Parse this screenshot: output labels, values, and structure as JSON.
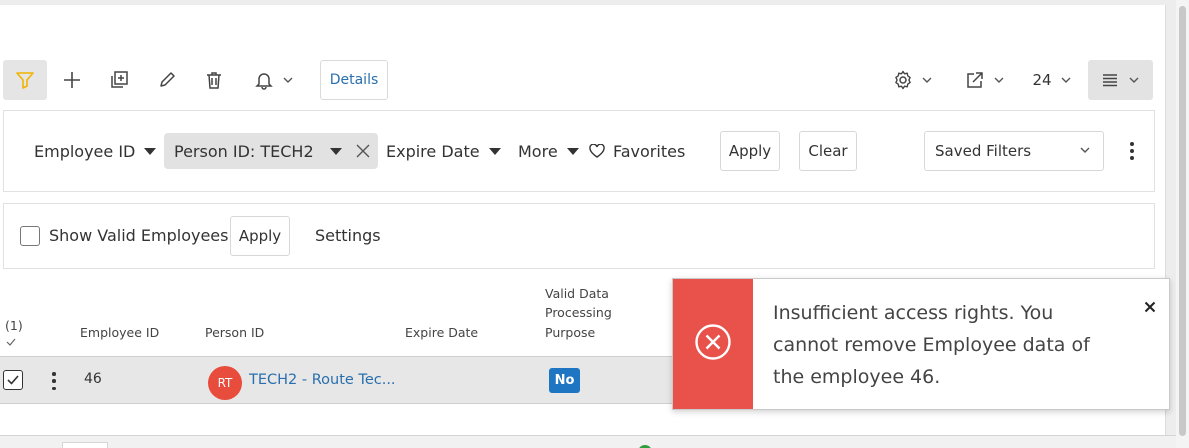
{
  "toolbar": {
    "details_label": "Details",
    "page_size": "24",
    "icons": [
      "filter-icon",
      "plus-icon",
      "duplicate-icon",
      "pencil-icon",
      "trash-icon",
      "bell-icon",
      "gear-icon",
      "export-icon",
      "list-view-icon"
    ]
  },
  "filters": {
    "employee_id": "Employee ID",
    "person_id": "Person ID: TECH2",
    "expire_date": "Expire Date",
    "more": "More",
    "favorites": "Favorites",
    "apply": "Apply",
    "clear": "Clear",
    "saved_filters": "Saved Filters"
  },
  "options": {
    "show_valid_employees": "Show Valid Employees",
    "apply": "Apply",
    "settings": "Settings"
  },
  "grid": {
    "selection_count": "(1)",
    "columns": {
      "employee_id": "Employee ID",
      "person_id": "Person ID",
      "expire_date": "Expire Date",
      "valid_purpose_1": "Valid Data",
      "valid_purpose_2": "Processing",
      "valid_purpose_3": "Purpose"
    },
    "rows": [
      {
        "employee_id": "46",
        "avatar_initials": "RT",
        "person": "TECH2 - Route Tec...",
        "valid_purpose": "No"
      }
    ]
  },
  "toast": {
    "message": "Insufficient access rights. You cannot remove Employee data of the employee 46."
  },
  "colors": {
    "accent_blue": "#1e76c2",
    "link_blue": "#2a6fad",
    "error_red": "#e9524a",
    "filter_active": "#f0b400"
  }
}
